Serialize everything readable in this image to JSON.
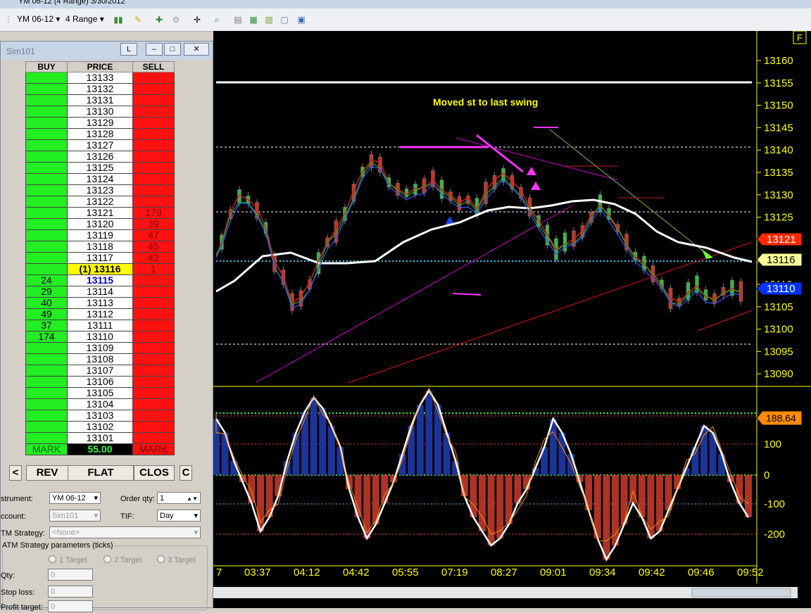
{
  "window": {
    "title": "YM 06-12 (4 Range)  3/30/2012"
  },
  "toolbar": {
    "instrument": "YM 06-12",
    "period": "4 Range"
  },
  "dom": {
    "title": "Sim101",
    "l_button": "L",
    "headers": {
      "buy": "BUY",
      "price": "PRICE",
      "sell": "SELL"
    },
    "rows": [
      {
        "buy": "",
        "price": "13133",
        "sell": ""
      },
      {
        "buy": "",
        "price": "13132",
        "sell": ""
      },
      {
        "buy": "",
        "price": "13131",
        "sell": ""
      },
      {
        "buy": "",
        "price": "13130",
        "sell": ""
      },
      {
        "buy": "",
        "price": "13129",
        "sell": ""
      },
      {
        "buy": "",
        "price": "13128",
        "sell": ""
      },
      {
        "buy": "",
        "price": "13127",
        "sell": ""
      },
      {
        "buy": "",
        "price": "13126",
        "sell": ""
      },
      {
        "buy": "",
        "price": "13125",
        "sell": ""
      },
      {
        "buy": "",
        "price": "13124",
        "sell": ""
      },
      {
        "buy": "",
        "price": "13123",
        "sell": ""
      },
      {
        "buy": "",
        "price": "13122",
        "sell": ""
      },
      {
        "buy": "",
        "price": "13121",
        "sell": "179"
      },
      {
        "buy": "",
        "price": "13120",
        "sell": "39"
      },
      {
        "buy": "",
        "price": "13119",
        "sell": "47"
      },
      {
        "buy": "",
        "price": "13118",
        "sell": "45"
      },
      {
        "buy": "",
        "price": "13117",
        "sell": "42"
      },
      {
        "buy": "",
        "price": "(1) 13116",
        "sell": "1",
        "hl": "yellow"
      },
      {
        "buy": "24",
        "price": "13115",
        "sell": "",
        "hl": "blue"
      },
      {
        "buy": "29",
        "price": "13114",
        "sell": ""
      },
      {
        "buy": "40",
        "price": "13113",
        "sell": ""
      },
      {
        "buy": "49",
        "price": "13112",
        "sell": ""
      },
      {
        "buy": "37",
        "price": "13111",
        "sell": ""
      },
      {
        "buy": "174",
        "price": "13110",
        "sell": ""
      },
      {
        "buy": "",
        "price": "13109",
        "sell": ""
      },
      {
        "buy": "",
        "price": "13108",
        "sell": ""
      },
      {
        "buy": "",
        "price": "13107",
        "sell": ""
      },
      {
        "buy": "",
        "price": "13106",
        "sell": ""
      },
      {
        "buy": "",
        "price": "13105",
        "sell": ""
      },
      {
        "buy": "",
        "price": "13104",
        "sell": ""
      },
      {
        "buy": "",
        "price": "13103",
        "sell": ""
      },
      {
        "buy": "",
        "price": "13102",
        "sell": ""
      },
      {
        "buy": "",
        "price": "13101",
        "sell": ""
      }
    ],
    "mark_left": "MARK",
    "pnl": "55.00",
    "mark_right": "MARK",
    "actions": {
      "left": "<",
      "rev": "REV",
      "flat": "FLAT",
      "close": "CLOS",
      "right": "C"
    },
    "form": {
      "instrument_label": "strument:",
      "instrument_value": "YM 06-12",
      "order_qty_label": "Order qty:",
      "order_qty_value": "1",
      "account_label": "ccount:",
      "account_value": "Sim101",
      "tif_label": "TIF:",
      "tif_value": "Day",
      "atm_label": "TM Strategy:",
      "atm_value": "<None>",
      "atm_params_label": "ATM Strategy parameters (ticks)",
      "targets": [
        "1 Target",
        "2 Target",
        "3 Target"
      ],
      "qty_label": "Qty:",
      "qty_value": "0",
      "stop_label": "Stop loss:",
      "stop_value": "0",
      "profit_label": "Profit target:",
      "profit_value": "0"
    }
  },
  "chart": {
    "annotation": "Moved st to last swing",
    "f_label": "F",
    "price_axis": [
      "13160",
      "13155",
      "13150",
      "13145",
      "13140",
      "13135",
      "13130",
      "13125",
      "13120",
      "13115",
      "13110",
      "13105",
      "13100",
      "13095",
      "13090"
    ],
    "price_markers": [
      {
        "label": "13121",
        "color": "#ff2a00"
      },
      {
        "label": "13116",
        "color": "#ffff99"
      },
      {
        "label": "13110",
        "color": "#0033ff"
      }
    ],
    "indicator_axis": [
      "100",
      "0",
      "-100",
      "-200"
    ],
    "indicator_marker": "188.64",
    "time_axis": [
      "7",
      "03:37",
      "04:12",
      "04:42",
      "05:55",
      "07:19",
      "08:27",
      "09:01",
      "09:34",
      "09:42",
      "09:46",
      "09:52"
    ]
  }
}
